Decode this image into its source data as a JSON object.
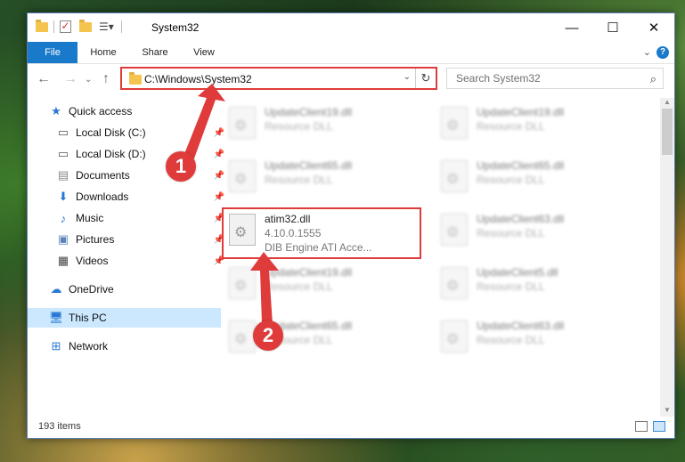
{
  "window": {
    "title": "System32",
    "controls": {
      "minimize": "—",
      "maximize": "☐",
      "close": "✕"
    }
  },
  "ribbon": {
    "tabs": [
      "File",
      "Home",
      "Share",
      "View"
    ],
    "help": "?"
  },
  "address": {
    "path": "C:\\Windows\\System32"
  },
  "search": {
    "placeholder": "Search System32"
  },
  "navpane": {
    "items": [
      {
        "label": "Quick access",
        "icon": "star-icon"
      },
      {
        "label": "Local Disk (C:)",
        "icon": "drive-icon",
        "pinned": true
      },
      {
        "label": "Local Disk (D:)",
        "icon": "drive-icon",
        "pinned": true
      },
      {
        "label": "Documents",
        "icon": "documents-icon",
        "pinned": true
      },
      {
        "label": "Downloads",
        "icon": "downloads-icon",
        "pinned": true
      },
      {
        "label": "Music",
        "icon": "music-icon",
        "pinned": true
      },
      {
        "label": "Pictures",
        "icon": "pictures-icon",
        "pinned": true
      },
      {
        "label": "Videos",
        "icon": "videos-icon",
        "pinned": true
      },
      {
        "label": "OneDrive",
        "icon": "cloud-icon"
      },
      {
        "label": "This PC",
        "icon": "computer-icon",
        "selected": true
      },
      {
        "label": "Network",
        "icon": "network-icon"
      }
    ]
  },
  "files": {
    "left": [
      {
        "name": "UpdateClient19.dll",
        "line2": "Resource DLL"
      },
      {
        "name": "UpdateClient65.dll",
        "line2": "Resource DLL"
      },
      {
        "name": "atim32.dll",
        "line2": "4.10.0.1555",
        "line3": "DIB Engine ATI Acce..."
      },
      {
        "name": "UpdateClient19.dll",
        "line2": "Resource DLL"
      },
      {
        "name": "UpdateClient65.dll",
        "line2": "Resource DLL"
      }
    ],
    "right": [
      {
        "name": "UpdateClient19.dll",
        "line2": "Resource DLL"
      },
      {
        "name": "UpdateClient65.dll",
        "line2": "Resource DLL"
      },
      {
        "name": "UpdateClient63.dll",
        "line2": "Resource DLL"
      },
      {
        "name": "UpdateClient5.dll",
        "line2": "Resource DLL"
      },
      {
        "name": "UpdateClient63.dll",
        "line2": "Resource DLL"
      }
    ]
  },
  "status": {
    "item_count": "193 items"
  },
  "annotations": {
    "step1": "1",
    "step2": "2",
    "color": "#e03b3b"
  }
}
